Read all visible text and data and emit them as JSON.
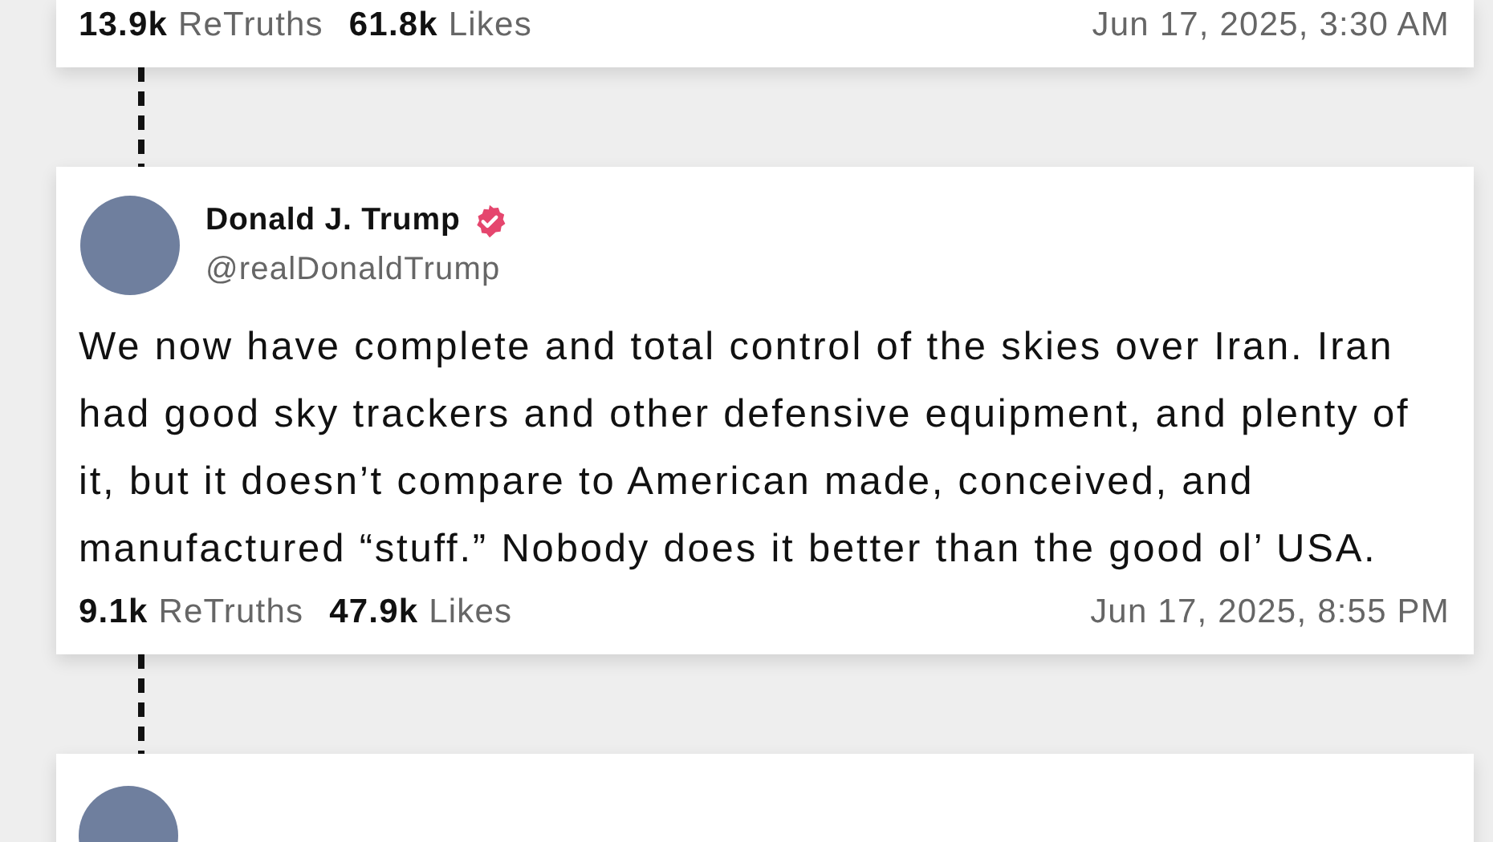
{
  "posts": [
    {
      "partial": true,
      "retruths_count": "13.9k",
      "retruths_label": "ReTruths",
      "likes_count": "61.8k",
      "likes_label": "Likes",
      "timestamp": "Jun 17, 2025, 3:30 AM"
    },
    {
      "partial": false,
      "author": "Donald J. Trump",
      "verified": true,
      "handle": "@realDonaldTrump",
      "text": "We now have complete and total control of the skies over Iran. Iran had good sky trackers and other defensive equipment, and plenty of it, but it doesn’t compare to American made, conceived, and manufactured “stuff.”  Nobody does it better than the good ol’ USA.",
      "retruths_count": "9.1k",
      "retruths_label": "ReTruths",
      "likes_count": "47.9k",
      "likes_label": "Likes",
      "timestamp": "Jun 17, 2025, 8:55 PM"
    }
  ]
}
